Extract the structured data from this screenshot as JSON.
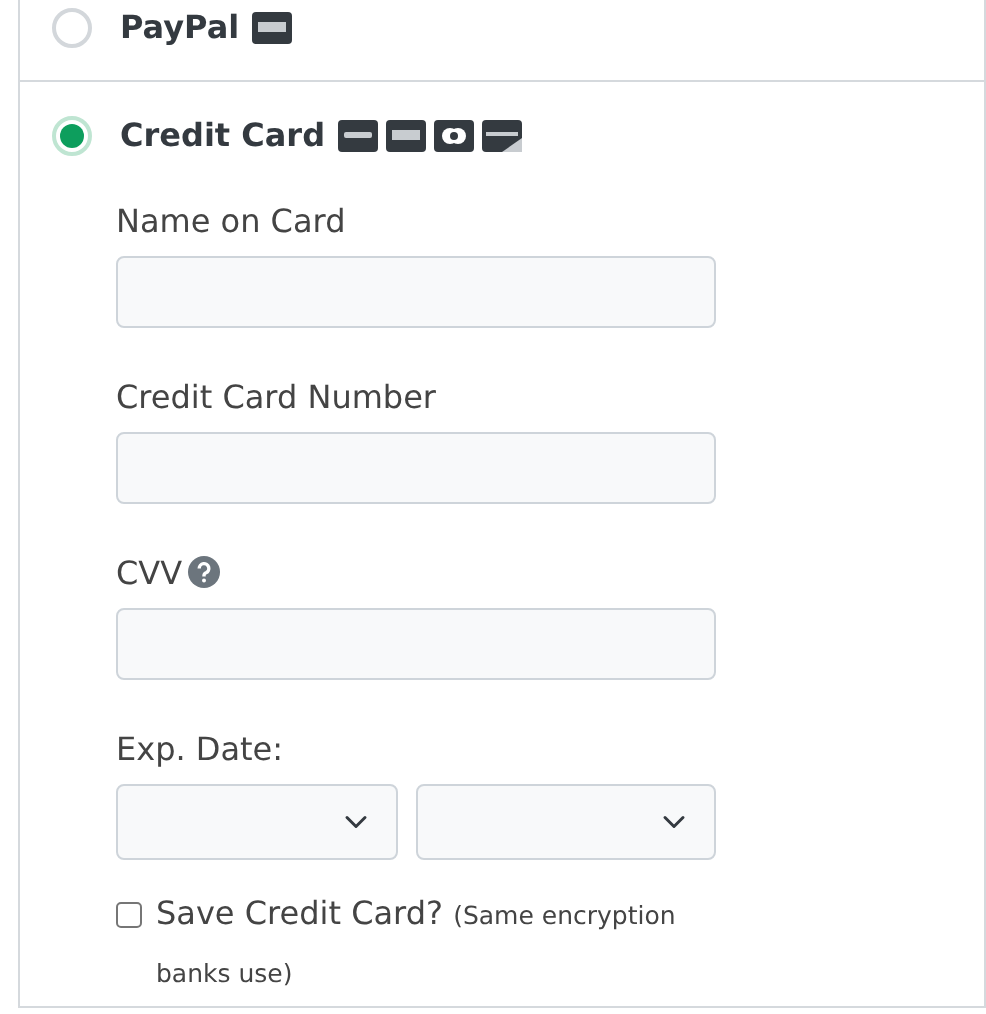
{
  "payment_methods": [
    {
      "kind": "paypal",
      "label": "PayPal",
      "selected": false
    },
    {
      "kind": "card",
      "label": "Credit Card",
      "selected": true
    }
  ],
  "card_form": {
    "fields": [
      {
        "kind": "text",
        "label": "Name on Card"
      },
      {
        "kind": "text",
        "label": "Credit Card Number"
      },
      {
        "kind": "text",
        "label": "CVV",
        "help_icon": true
      },
      {
        "kind": "select-pair",
        "label": "Exp. Date:"
      }
    ],
    "save_option": {
      "label": "Save Credit Card?",
      "note": "(Same encryption banks use)",
      "checked": false
    }
  }
}
